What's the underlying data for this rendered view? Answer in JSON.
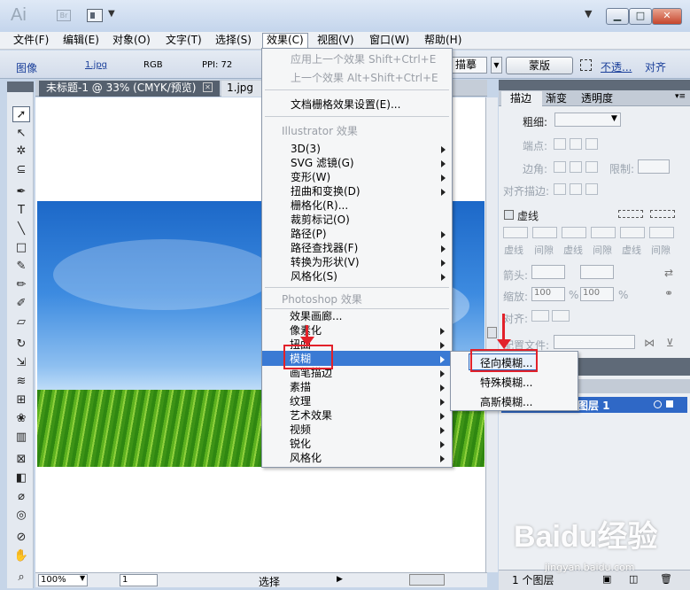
{
  "titlebar": {
    "app_logo": "Ai",
    "bridge_logo": "Br",
    "workspace_caret": "▼",
    "minimize": "▁",
    "maximize": "□",
    "close": "✕"
  },
  "menubar": {
    "items": [
      "文件(F)",
      "编辑(E)",
      "对象(O)",
      "文字(T)",
      "选择(S)",
      "效果(C)",
      "视图(V)",
      "窗口(W)",
      "帮助(H)"
    ]
  },
  "control_bar": {
    "image_label": "图像",
    "file_name": "1.jpg",
    "color_mode": "RGB",
    "ppi": "PPI: 72",
    "trace_preset": "描摹",
    "mask_button": "蒙版",
    "opacity_link": "不透...",
    "align_link": "对齐"
  },
  "document_tabs": {
    "tab1": "未标题-1 @ 33% (CMYK/预览)",
    "tab1_close": "✕",
    "tab2": "1.jpg @"
  },
  "effect_menu": {
    "apply_last": "应用上一个效果",
    "apply_last_shortcut": "Shift+Ctrl+E",
    "last_effect": "上一个效果",
    "last_effect_shortcut": "Alt+Shift+Ctrl+E",
    "raster_settings": "文档栅格效果设置(E)...",
    "illustrator_header": "Illustrator 效果",
    "illustrator_items": [
      "3D(3)",
      "SVG 滤镜(G)",
      "变形(W)",
      "扭曲和变换(D)",
      "栅格化(R)...",
      "裁剪标记(O)",
      "路径(P)",
      "路径查找器(F)",
      "转换为形状(V)",
      "风格化(S)"
    ],
    "photoshop_header": "Photoshop 效果",
    "photoshop_items": [
      "效果画廊...",
      "像素化",
      "扭曲",
      "模糊",
      "画笔描边",
      "素描",
      "纹理",
      "艺术效果",
      "视频",
      "锐化",
      "风格化"
    ]
  },
  "blur_submenu": {
    "items": [
      "径向模糊...",
      "特殊模糊...",
      "高斯模糊..."
    ]
  },
  "stroke_panel": {
    "tabs": [
      "描边",
      "渐变",
      "透明度"
    ],
    "weight_label": "粗细:",
    "cap_label": "端点:",
    "corner_label": "边角:",
    "limit_label": "限制:",
    "align_label": "对齐描边:",
    "dashed_label": "虚线",
    "dash_labels": [
      "虚线",
      "间隙",
      "虚线",
      "间隙",
      "虚线",
      "间隙"
    ],
    "arrow_label": "箭头:",
    "scale_label": "缩放:",
    "scale_value_1": "100",
    "scale_value_2": "100",
    "percent": "%",
    "align_arrow_label": "对齐:",
    "profile_label": "配置文件:"
  },
  "layers_panel": {
    "layer_name": "图层 1",
    "layer_count": "1 个图层"
  },
  "status_bar": {
    "zoom": "100%",
    "page": "1",
    "status": "选择"
  },
  "watermark": {
    "text": "Baidu经验",
    "url": "jingyan.baidu.com"
  },
  "colors": {
    "accent": "#3a7ad4",
    "annotation": "#e2212a",
    "menu_bg": "#f5f6f7"
  }
}
